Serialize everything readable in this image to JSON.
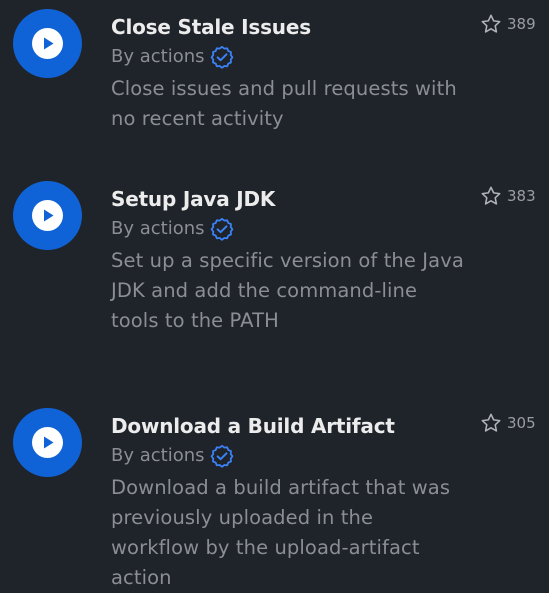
{
  "colors": {
    "background": "#1f232a",
    "accent_blue": "#1063d6",
    "verified_blue": "#3b82f6",
    "title_text": "#ececec",
    "muted_text": "#8b8f94"
  },
  "actions": [
    {
      "title": "Close Stale Issues",
      "author": "By actions",
      "description": "Close issues and pull requests with no recent activity",
      "stars": "389",
      "icon": "play-circle-icon",
      "verified_icon": "verified-badge-icon"
    },
    {
      "title": "Setup Java JDK",
      "author": "By actions",
      "description": "Set up a specific version of the Java JDK and add the command-line tools to the PATH",
      "stars": "383",
      "icon": "play-circle-icon",
      "verified_icon": "verified-badge-icon"
    },
    {
      "title": "Download a Build Artifact",
      "author": "By actions",
      "description": "Download a build artifact that was previously uploaded in the workflow by the upload-artifact action",
      "stars": "305",
      "icon": "play-circle-icon",
      "verified_icon": "verified-badge-icon"
    }
  ]
}
